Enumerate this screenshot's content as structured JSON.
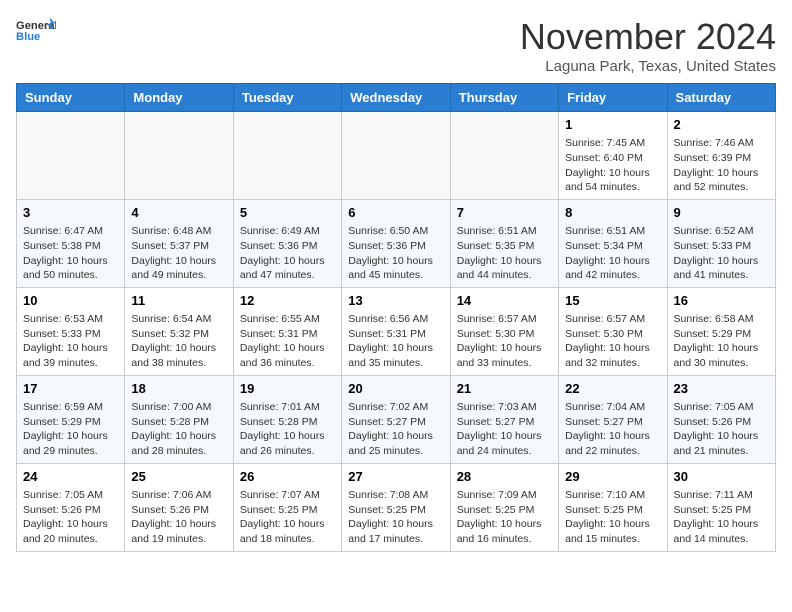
{
  "header": {
    "logo_general": "General",
    "logo_blue": "Blue",
    "month": "November 2024",
    "location": "Laguna Park, Texas, United States"
  },
  "weekdays": [
    "Sunday",
    "Monday",
    "Tuesday",
    "Wednesday",
    "Thursday",
    "Friday",
    "Saturday"
  ],
  "weeks": [
    [
      {
        "num": "",
        "info": ""
      },
      {
        "num": "",
        "info": ""
      },
      {
        "num": "",
        "info": ""
      },
      {
        "num": "",
        "info": ""
      },
      {
        "num": "",
        "info": ""
      },
      {
        "num": "1",
        "info": "Sunrise: 7:45 AM\nSunset: 6:40 PM\nDaylight: 10 hours and 54 minutes."
      },
      {
        "num": "2",
        "info": "Sunrise: 7:46 AM\nSunset: 6:39 PM\nDaylight: 10 hours and 52 minutes."
      }
    ],
    [
      {
        "num": "3",
        "info": "Sunrise: 6:47 AM\nSunset: 5:38 PM\nDaylight: 10 hours and 50 minutes."
      },
      {
        "num": "4",
        "info": "Sunrise: 6:48 AM\nSunset: 5:37 PM\nDaylight: 10 hours and 49 minutes."
      },
      {
        "num": "5",
        "info": "Sunrise: 6:49 AM\nSunset: 5:36 PM\nDaylight: 10 hours and 47 minutes."
      },
      {
        "num": "6",
        "info": "Sunrise: 6:50 AM\nSunset: 5:36 PM\nDaylight: 10 hours and 45 minutes."
      },
      {
        "num": "7",
        "info": "Sunrise: 6:51 AM\nSunset: 5:35 PM\nDaylight: 10 hours and 44 minutes."
      },
      {
        "num": "8",
        "info": "Sunrise: 6:51 AM\nSunset: 5:34 PM\nDaylight: 10 hours and 42 minutes."
      },
      {
        "num": "9",
        "info": "Sunrise: 6:52 AM\nSunset: 5:33 PM\nDaylight: 10 hours and 41 minutes."
      }
    ],
    [
      {
        "num": "10",
        "info": "Sunrise: 6:53 AM\nSunset: 5:33 PM\nDaylight: 10 hours and 39 minutes."
      },
      {
        "num": "11",
        "info": "Sunrise: 6:54 AM\nSunset: 5:32 PM\nDaylight: 10 hours and 38 minutes."
      },
      {
        "num": "12",
        "info": "Sunrise: 6:55 AM\nSunset: 5:31 PM\nDaylight: 10 hours and 36 minutes."
      },
      {
        "num": "13",
        "info": "Sunrise: 6:56 AM\nSunset: 5:31 PM\nDaylight: 10 hours and 35 minutes."
      },
      {
        "num": "14",
        "info": "Sunrise: 6:57 AM\nSunset: 5:30 PM\nDaylight: 10 hours and 33 minutes."
      },
      {
        "num": "15",
        "info": "Sunrise: 6:57 AM\nSunset: 5:30 PM\nDaylight: 10 hours and 32 minutes."
      },
      {
        "num": "16",
        "info": "Sunrise: 6:58 AM\nSunset: 5:29 PM\nDaylight: 10 hours and 30 minutes."
      }
    ],
    [
      {
        "num": "17",
        "info": "Sunrise: 6:59 AM\nSunset: 5:29 PM\nDaylight: 10 hours and 29 minutes."
      },
      {
        "num": "18",
        "info": "Sunrise: 7:00 AM\nSunset: 5:28 PM\nDaylight: 10 hours and 28 minutes."
      },
      {
        "num": "19",
        "info": "Sunrise: 7:01 AM\nSunset: 5:28 PM\nDaylight: 10 hours and 26 minutes."
      },
      {
        "num": "20",
        "info": "Sunrise: 7:02 AM\nSunset: 5:27 PM\nDaylight: 10 hours and 25 minutes."
      },
      {
        "num": "21",
        "info": "Sunrise: 7:03 AM\nSunset: 5:27 PM\nDaylight: 10 hours and 24 minutes."
      },
      {
        "num": "22",
        "info": "Sunrise: 7:04 AM\nSunset: 5:27 PM\nDaylight: 10 hours and 22 minutes."
      },
      {
        "num": "23",
        "info": "Sunrise: 7:05 AM\nSunset: 5:26 PM\nDaylight: 10 hours and 21 minutes."
      }
    ],
    [
      {
        "num": "24",
        "info": "Sunrise: 7:05 AM\nSunset: 5:26 PM\nDaylight: 10 hours and 20 minutes."
      },
      {
        "num": "25",
        "info": "Sunrise: 7:06 AM\nSunset: 5:26 PM\nDaylight: 10 hours and 19 minutes."
      },
      {
        "num": "26",
        "info": "Sunrise: 7:07 AM\nSunset: 5:25 PM\nDaylight: 10 hours and 18 minutes."
      },
      {
        "num": "27",
        "info": "Sunrise: 7:08 AM\nSunset: 5:25 PM\nDaylight: 10 hours and 17 minutes."
      },
      {
        "num": "28",
        "info": "Sunrise: 7:09 AM\nSunset: 5:25 PM\nDaylight: 10 hours and 16 minutes."
      },
      {
        "num": "29",
        "info": "Sunrise: 7:10 AM\nSunset: 5:25 PM\nDaylight: 10 hours and 15 minutes."
      },
      {
        "num": "30",
        "info": "Sunrise: 7:11 AM\nSunset: 5:25 PM\nDaylight: 10 hours and 14 minutes."
      }
    ]
  ]
}
